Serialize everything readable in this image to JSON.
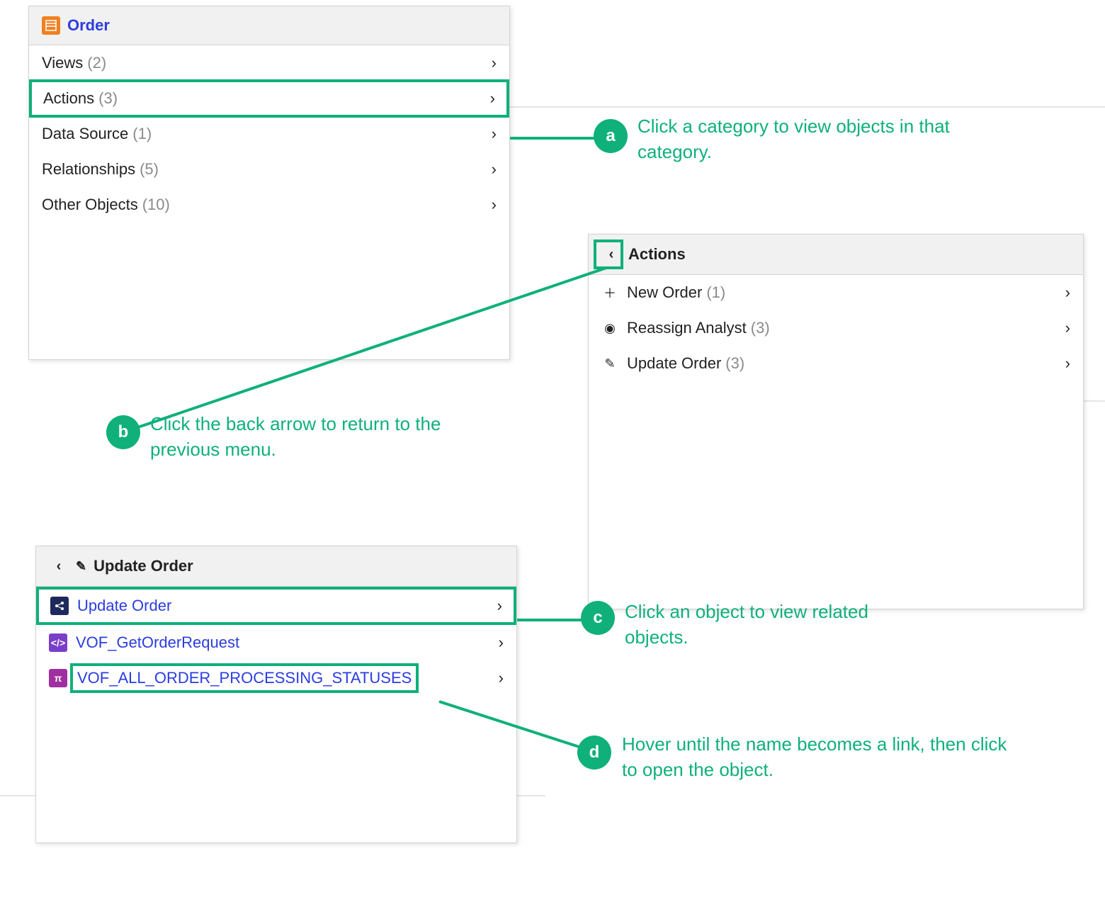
{
  "panel_order": {
    "title": "Order",
    "items": [
      {
        "label": "Views",
        "count": "(2)"
      },
      {
        "label": "Actions",
        "count": "(3)"
      },
      {
        "label": "Data Source",
        "count": "(1)"
      },
      {
        "label": "Relationships",
        "count": "(5)"
      },
      {
        "label": "Other Objects",
        "count": "(10)"
      }
    ]
  },
  "panel_actions": {
    "title": "Actions",
    "items": [
      {
        "icon": "＋",
        "label": "New Order",
        "count": "(1)"
      },
      {
        "icon": "◉",
        "label": "Reassign Analyst",
        "count": "(3)"
      },
      {
        "icon": "✎",
        "label": "Update Order",
        "count": "(3)"
      }
    ]
  },
  "panel_update": {
    "title": "Update Order",
    "items": [
      {
        "label": "Update Order"
      },
      {
        "label": "VOF_GetOrderRequest"
      },
      {
        "label": "VOF_ALL_ORDER_PROCESSING_STATUSES"
      }
    ]
  },
  "callouts": {
    "a": {
      "letter": "a",
      "text": "Click a category to view objects in that category."
    },
    "b": {
      "letter": "b",
      "text": "Click the back arrow to return to the previous menu."
    },
    "c": {
      "letter": "c",
      "text": "Click an object to view related objects."
    },
    "d": {
      "letter": "d",
      "text": "Hover until the name becomes a link, then click to open the object."
    }
  }
}
